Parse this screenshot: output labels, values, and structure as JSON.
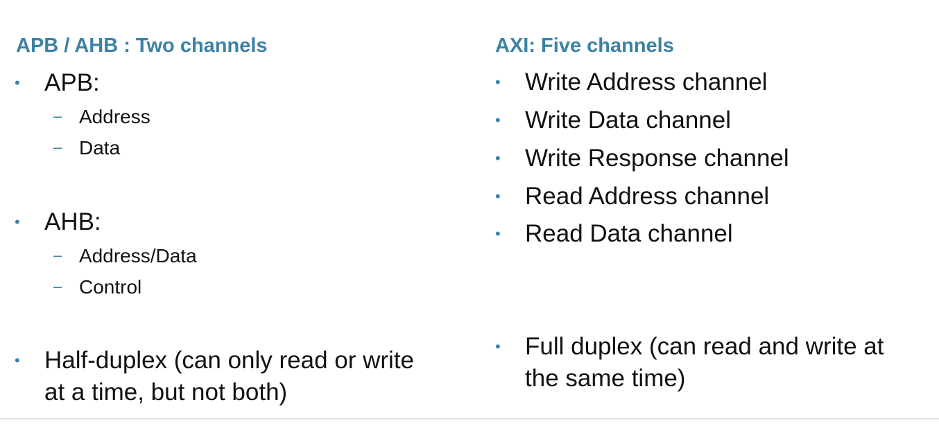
{
  "left": {
    "title": "APB / AHB : Two channels",
    "apb": {
      "label": "APB:",
      "items": [
        "Address",
        "Data"
      ]
    },
    "ahb": {
      "label": "AHB:",
      "items": [
        "Address/Data",
        "Control"
      ]
    },
    "note_line1": "Half-duplex (can only read or write",
    "note_line2": "at a time, but not both)"
  },
  "right": {
    "title": "AXI: Five channels",
    "items": [
      "Write Address channel",
      "Write Data channel",
      "Write Response channel",
      "Read Address channel",
      "Read Data channel"
    ],
    "note_line1": "Full duplex (can read and write at",
    "note_line2": "the same time)"
  },
  "symbols": {
    "bullet": "•",
    "dash": "–"
  },
  "colors": {
    "accent": "#3B82A6",
    "text": "#111111"
  }
}
